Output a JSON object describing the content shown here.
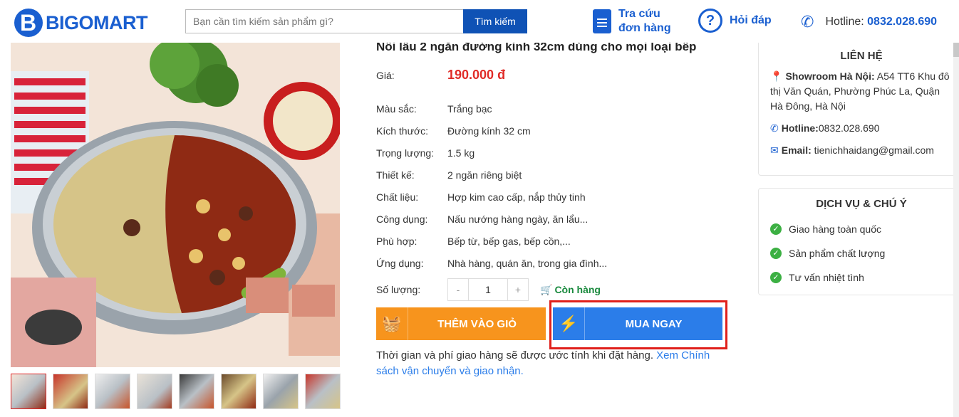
{
  "header": {
    "logo": "BIGOMART",
    "search_placeholder": "Bạn cần tìm kiếm sản phẩm gì?",
    "search_button": "Tìm kiếm",
    "order_lookup": "Tra cứu đơn hàng",
    "faq": "Hỏi đáp",
    "hotline_label": "Hotline:",
    "hotline_number": "0832.028.690"
  },
  "product": {
    "title": "Nồi lẩu 2 ngăn đường kính 32cm dùng cho mọi loại bếp",
    "price_label": "Giá:",
    "price": "190.000 đ",
    "specs": [
      {
        "label": "Màu sắc:",
        "value": "Trắng bạc"
      },
      {
        "label": "Kích thước:",
        "value": "Đường kính 32 cm"
      },
      {
        "label": "Trọng lượng:",
        "value": "1.5 kg"
      },
      {
        "label": "Thiết kế:",
        "value": "2 ngăn riêng biệt"
      },
      {
        "label": "Chất liệu:",
        "value": "Hợp kim cao cấp, nắp thủy tinh"
      },
      {
        "label": "Công dụng:",
        "value": "Nấu nướng hàng ngày, ăn lẩu..."
      },
      {
        "label": "Phù hợp:",
        "value": "Bếp từ, bếp gas, bếp cồn,..."
      },
      {
        "label": "Ứng dụng:",
        "value": "Nhà hàng, quán ăn, trong gia đình..."
      }
    ],
    "qty_label": "Số lượng:",
    "qty_minus": "-",
    "qty_value": "1",
    "qty_plus": "+",
    "stock": "Còn hàng",
    "add_to_cart": "THÊM VÀO GIỎ",
    "buy_now": "MUA NGAY",
    "note": "Thời gian và phí giao hàng sẽ được ước tính khi đặt hàng.",
    "note_link": "Xem Chính sách vận chuyển và giao nhận."
  },
  "contact": {
    "title": "LIÊN HỆ",
    "showroom_label": "Showroom Hà Nội:",
    "showroom_addr": "A54 TT6 Khu đô thị Văn Quán, Phường Phúc La, Quận Hà Đông, Hà Nội",
    "hotline_label": "Hotline:",
    "hotline": "0832.028.690",
    "email_label": "Email:",
    "email": "tienichhaidang@gmail.com"
  },
  "services": {
    "title": "DỊCH VỤ & CHÚ Ý",
    "items": [
      "Giao hàng toàn quốc",
      "Sản phẩm chất lượng",
      "Tư vấn nhiệt tình"
    ]
  },
  "colors": {
    "brand": "#1a5fd0",
    "price": "#e02b27",
    "cart": "#f7941d",
    "buy": "#2b7de9",
    "highlight": "#e0201b"
  }
}
